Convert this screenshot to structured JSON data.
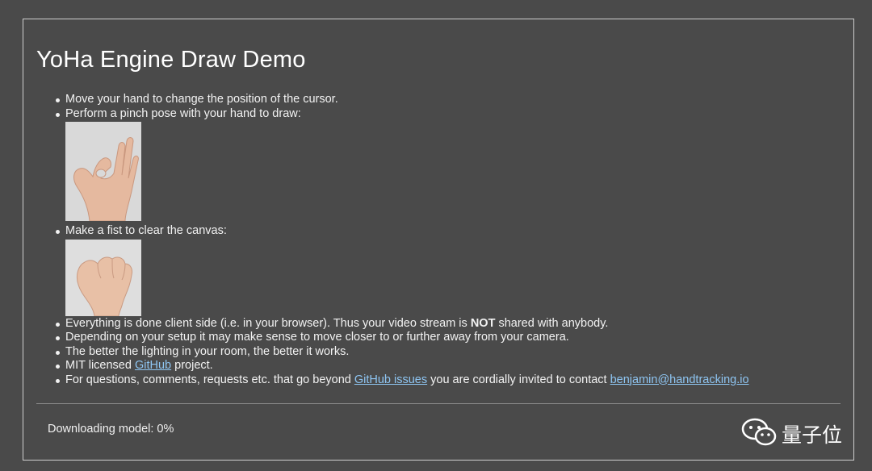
{
  "page": {
    "title": "YoHa Engine Draw Demo"
  },
  "instructions": {
    "move": "Move your hand to change the position of the cursor.",
    "pinch": "Perform a pinch pose with your hand to draw:",
    "fist": "Make a fist to clear the canvas:",
    "client_side_prefix": "Everything is done client side (i.e. in your browser). Thus your video stream is ",
    "client_side_bold": "NOT",
    "client_side_suffix": " shared with anybody.",
    "distance": "Depending on your setup it may make sense to move closer to or further away from your camera.",
    "lighting": "The better the lighting in your room, the better it works.",
    "license_prefix": "MIT licensed ",
    "license_link": "GitHub",
    "license_suffix": " project.",
    "contact_prefix": "For questions, comments, requests etc. that go beyond ",
    "contact_issues_link": "GitHub issues",
    "contact_middle": " you are cordially invited to contact ",
    "contact_email": "benjamin@handtracking.io"
  },
  "images": {
    "pinch": "pinch-hand-photo",
    "fist": "fist-hand-photo"
  },
  "status": {
    "label": "Downloading model: 0%",
    "progress_percent": 0
  },
  "watermark": {
    "text": "量子位",
    "icon": "wechat-icon"
  },
  "colors": {
    "background": "#4a4a4a",
    "link": "#8ec5f2",
    "text": "#f2f2f2"
  }
}
